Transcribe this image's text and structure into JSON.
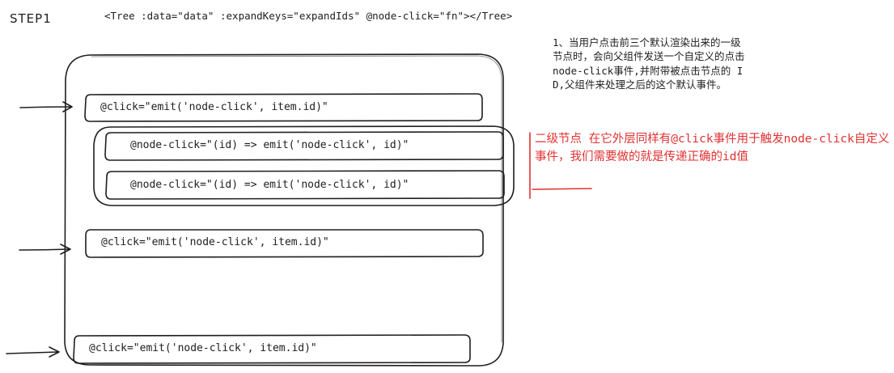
{
  "step_label": "STEP1",
  "tree_tag": "<Tree :data=\"data\" :expandKeys=\"expandIds\" @node-click=\"fn\"></Tree>",
  "nodes": [
    {
      "code": "@click=\"emit('node-click', item.id)\""
    },
    {
      "code": "@node-click=\"(id) => emit('node-click', id)\""
    },
    {
      "code": "@node-click=\"(id) => emit('node-click', id)\""
    },
    {
      "code": "@click=\"emit('node-click', item.id)\""
    },
    {
      "code": "@click=\"emit('node-click', item.id)\""
    }
  ],
  "note_black": "1、当用户点击前三个默认渲染出来的一级节点时，会向父组件发送一个自定义的点击node-click事件,并附带被点击节点的 ID,父组件来处理之后的这个默认事件。",
  "note_red": "二级节点   在它外层同样有@click事件用于触发node-click自定义事件，我们需要做的就是传递正确的id值",
  "colors": {
    "ink": "#1e1e1e",
    "accent": "#e03131"
  }
}
